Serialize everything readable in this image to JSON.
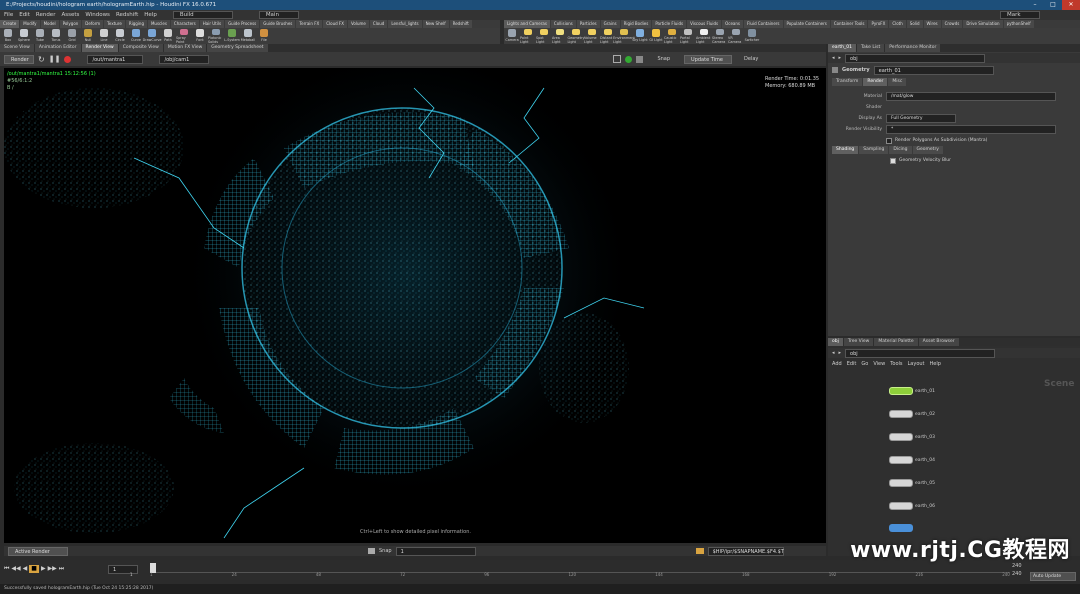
{
  "window": {
    "title": "E:/Projects/houdini/hologram earth/hologramEarth.hip - Houdini FX 16.0.671",
    "min": "–",
    "max": "□",
    "close": "✕"
  },
  "menu": {
    "items": [
      "File",
      "Edit",
      "Render",
      "Assets",
      "Windows",
      "Redshift",
      "Help"
    ],
    "build": "Build",
    "desktop": "Main",
    "user": "Mark"
  },
  "shelf_tabs_left": [
    "Create",
    "Modify",
    "Model",
    "Polygon",
    "Deform",
    "Texture",
    "Rigging",
    "Muscles",
    "Characters",
    "Hair Utils",
    "Guide Process",
    "Guide Brushes",
    "Terrain FX",
    "Cloud FX",
    "Volume",
    "Cloud",
    "Lensful_lights",
    "New Shelf",
    "Redshift"
  ],
  "shelf_tabs_right": [
    "Lights and Cameras",
    "Collisions",
    "Particles",
    "Grains",
    "Rigid Bodies",
    "Particle Fluids",
    "Viscous Fluids",
    "Oceans",
    "Fluid Containers",
    "Populate Containers",
    "Container Tools",
    "PyroFX",
    "Cloth",
    "Solid",
    "Wires",
    "Crowds",
    "Drive Simulation",
    "pythonShelf"
  ],
  "shelf_tools_left": [
    {
      "label": "Box",
      "color": "#aab0b8"
    },
    {
      "label": "Sphere",
      "color": "#c8ccd2"
    },
    {
      "label": "Tube",
      "color": "#aab0b8"
    },
    {
      "label": "Torus",
      "color": "#b7bcc3"
    },
    {
      "label": "Grid",
      "color": "#9aa0a8"
    },
    {
      "label": "Null",
      "color": "#c4a040"
    },
    {
      "label": "Line",
      "color": "#d0d0d0"
    },
    {
      "label": "Circle",
      "color": "#c8ccd2"
    },
    {
      "label": "Curve",
      "color": "#7aa6d6"
    },
    {
      "label": "DrawCurve",
      "color": "#7aa6d6"
    },
    {
      "label": "Path",
      "color": "#d0d0d0"
    },
    {
      "label": "Spray Paint",
      "color": "#d07090"
    },
    {
      "label": "Font",
      "color": "#dddddd"
    },
    {
      "label": "Platonic Solids",
      "color": "#8a9cb0"
    },
    {
      "label": "L-System",
      "color": "#6aa050"
    },
    {
      "label": "Metaball",
      "color": "#bcc4cc"
    },
    {
      "label": "File",
      "color": "#d09040"
    }
  ],
  "shelf_tools_right": [
    {
      "label": "Camera",
      "color": "#9aa4b0"
    },
    {
      "label": "Point Light",
      "color": "#f0d060"
    },
    {
      "label": "Spot Light",
      "color": "#f0d060"
    },
    {
      "label": "Area Light",
      "color": "#f0e080"
    },
    {
      "label": "Geometry Light",
      "color": "#f0d060"
    },
    {
      "label": "Volume Light",
      "color": "#f0d060"
    },
    {
      "label": "Distant Light",
      "color": "#f0d060"
    },
    {
      "label": "Environment Light",
      "color": "#e0c050"
    },
    {
      "label": "Sky Light",
      "color": "#80b0e0"
    },
    {
      "label": "GI Light",
      "color": "#f0c040"
    },
    {
      "label": "Caustic Light",
      "color": "#e0b040"
    },
    {
      "label": "Portal Light",
      "color": "#c0c0c0"
    },
    {
      "label": "Ambient Light",
      "color": "#f0f0f0"
    },
    {
      "label": "Stereo Camera",
      "color": "#9aa4b0"
    },
    {
      "label": "VR Camera",
      "color": "#9aa4b0"
    },
    {
      "label": "Switcher",
      "color": "#8090a0"
    }
  ],
  "left_pane_tabs": [
    "Scene View",
    "Animation Editor",
    "Render View",
    "Composite View",
    "Motion FX View",
    "Geometry Spreadsheet"
  ],
  "render_toolbar": {
    "render_btn": "Render",
    "rop_path": "/out/mantra1",
    "camera_path": "/obj/cam1",
    "snap_label": "Snap",
    "update_time": "Update Time",
    "delay": "Delay"
  },
  "viewport": {
    "overlay_path": "/out/mantra1/mantra1 15:12:56 (1)",
    "overlay_sub": "#56/6:1:2",
    "overlay_sub2": "B /",
    "render_time": "Render Time: 0:01.35",
    "memory": "Memory:  680.89 MB",
    "hint": "Ctrl+Left to show detailed pixel information."
  },
  "render_status": {
    "active_render": "Active Render",
    "snap": "Snap",
    "snap_value": "1",
    "output_path": "$HIP/ipr/$SNAPNAME.$F4.$T"
  },
  "right_tabs": [
    "earth_01",
    "Take List",
    "Performance Monitor"
  ],
  "param": {
    "path": "obj",
    "node_type": "Geometry",
    "node_name": "earth_01",
    "tabs": [
      "Transform",
      "Render",
      "Misc"
    ],
    "material_label": "Material",
    "material_value": "/mat/glow",
    "shader_label": "Shader",
    "display_as_label": "Display As",
    "display_as_value": "Full Geometry",
    "render_visibility_label": "Render Visibility",
    "render_visibility_value": "*",
    "render_polygons_label": "Render Polygons As Subdivision (Mantra)",
    "sub_tabs": [
      "Shading",
      "Sampling",
      "Dicing",
      "Geometry"
    ],
    "velocity_blur_label": "Geometry Velocity Blur"
  },
  "network": {
    "tabs": [
      "obj",
      "Tree View",
      "Material Palette",
      "Asset Browser"
    ],
    "path": "obj",
    "menu": [
      "Add",
      "Edit",
      "Go",
      "View",
      "Tools",
      "Layout",
      "Help"
    ],
    "context_label": "Scene",
    "nodes": [
      {
        "name": "earth_01",
        "active": true
      },
      {
        "name": "earth_02",
        "active": false
      },
      {
        "name": "earth_03",
        "active": false
      },
      {
        "name": "earth_04",
        "active": false
      },
      {
        "name": "earth_05",
        "active": false
      },
      {
        "name": "earth_06",
        "active": false
      }
    ]
  },
  "timeline": {
    "frame": "1",
    "start": "1",
    "start2": "1",
    "end": "240",
    "end2": "240",
    "ticks": [
      "1",
      "24",
      "48",
      "72",
      "96",
      "120",
      "144",
      "168",
      "192",
      "216",
      "240"
    ],
    "auto_update": "Auto Update"
  },
  "status_message": "Successfully saved hologramEarth.hip (Tue Oct 24 15:25:28 2017)",
  "watermark": "www.rjtj.CG教程网"
}
